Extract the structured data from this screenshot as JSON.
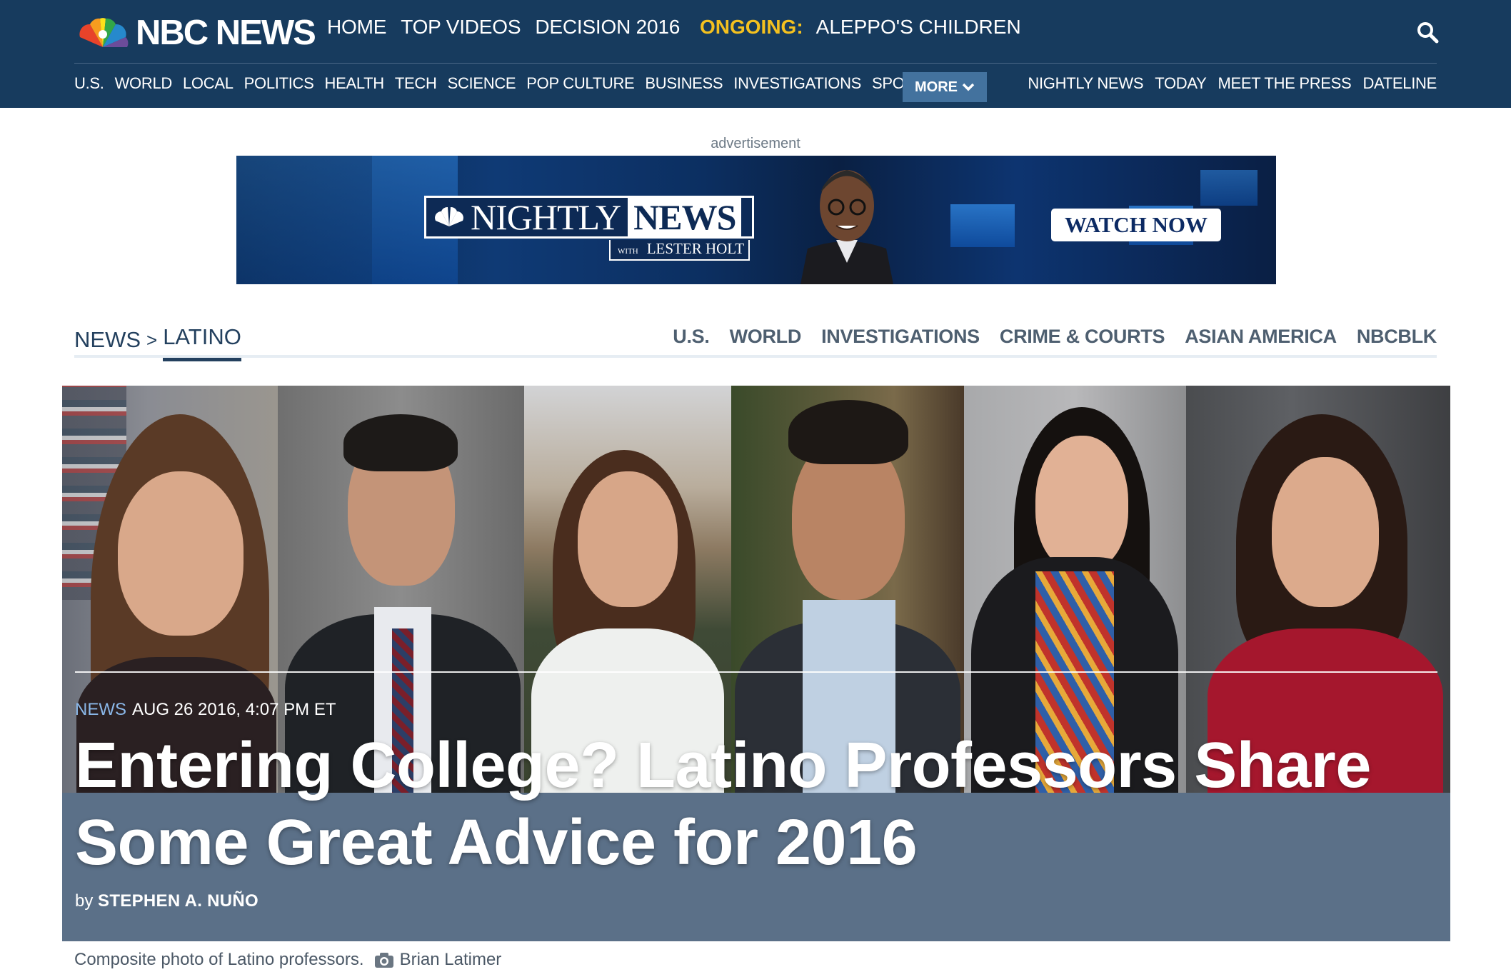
{
  "header": {
    "logo_text": "NBC NEWS",
    "top_nav": [
      "HOME",
      "TOP VIDEOS",
      "DECISION 2016"
    ],
    "ongoing_label": "ONGOING:",
    "ongoing_link": "ALEPPO'S CHILDREN",
    "search_icon": "search-icon",
    "sub_nav": [
      "U.S.",
      "WORLD",
      "LOCAL",
      "POLITICS",
      "HEALTH",
      "TECH",
      "SCIENCE",
      "POP CULTURE",
      "BUSINESS",
      "INVESTIGATIONS",
      "SPORTS"
    ],
    "more_label": "MORE",
    "shows": [
      "NIGHTLY NEWS",
      "TODAY",
      "MEET THE PRESS",
      "DATELINE"
    ]
  },
  "ad": {
    "label": "advertisement",
    "nightly_a": "NIGHTLY",
    "nightly_b": "NEWS",
    "with": "WITH",
    "anchor": "LESTER HOLT",
    "cta": "WATCH NOW"
  },
  "section": {
    "crumb_news": "NEWS",
    "crumb_sep": ">",
    "crumb_current": "LATINO",
    "links": [
      "U.S.",
      "WORLD",
      "INVESTIGATIONS",
      "CRIME & COURTS",
      "ASIAN AMERICA",
      "NBCBLK"
    ]
  },
  "article": {
    "tag": "NEWS",
    "date": "AUG 26 2016, 4:07 PM ET",
    "headline": "Entering College? Latino Professors Share Some Great Advice for 2016",
    "by": "by",
    "author": "STEPHEN A. NUÑO",
    "caption": "Composite photo of Latino professors.",
    "photo_credit": "Brian Latimer"
  },
  "colors": {
    "header_bg": "#173b5e",
    "ongoing": "#f4c11f",
    "more_bg": "#43729e",
    "hero_band": "#5b7088",
    "tag": "#8ab7e8"
  }
}
